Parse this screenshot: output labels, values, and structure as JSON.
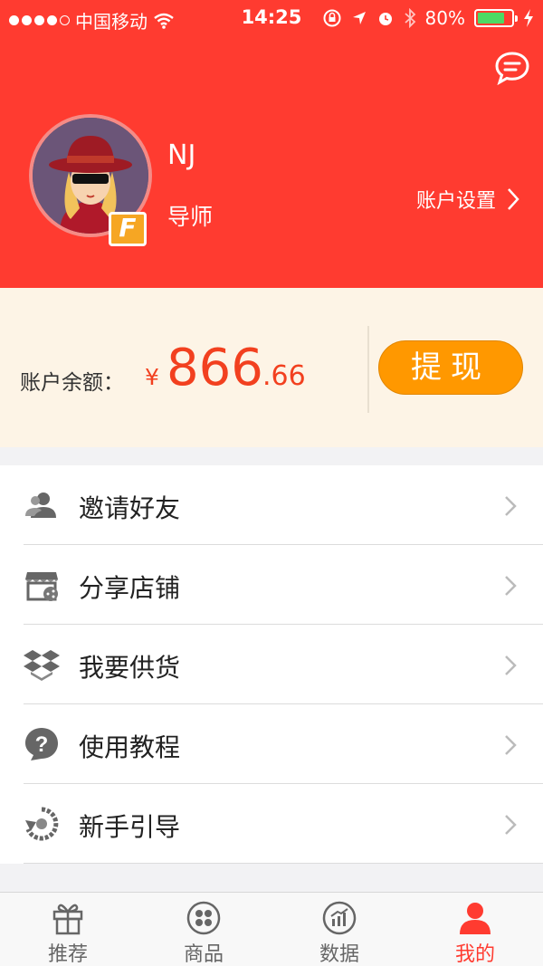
{
  "status_bar": {
    "carrier": "中国移动",
    "time": "14:25",
    "battery": "80%",
    "battery_level": 0.8,
    "signal_dots": 5,
    "signal_filled": 4
  },
  "header": {
    "background_color": "#ff3b30",
    "user_name": "NJ",
    "user_role": "导师",
    "badge_letter": "F",
    "account_settings_label": "账户设置"
  },
  "balance": {
    "label": "账户余额：",
    "currency": "¥",
    "amount_integer": "866",
    "amount_decimal": ".66",
    "withdraw_label": "提现",
    "accent_color": "#f2401f",
    "button_color": "#ff9800"
  },
  "menu": {
    "items": [
      {
        "label": "邀请好友",
        "icon": "invite-friends-icon"
      },
      {
        "label": "分享店铺",
        "icon": "share-store-icon"
      },
      {
        "label": "我要供货",
        "icon": "supply-box-icon"
      },
      {
        "label": "使用教程",
        "icon": "help-question-icon"
      },
      {
        "label": "新手引导",
        "icon": "guide-refresh-icon"
      }
    ]
  },
  "tab_bar": {
    "active_color": "#ff3b30",
    "tabs": [
      {
        "label": "推荐",
        "icon": "gift-icon"
      },
      {
        "label": "商品",
        "icon": "grid-circle-icon"
      },
      {
        "label": "数据",
        "icon": "chart-circle-icon"
      },
      {
        "label": "我的",
        "icon": "user-icon",
        "active": true
      }
    ]
  }
}
